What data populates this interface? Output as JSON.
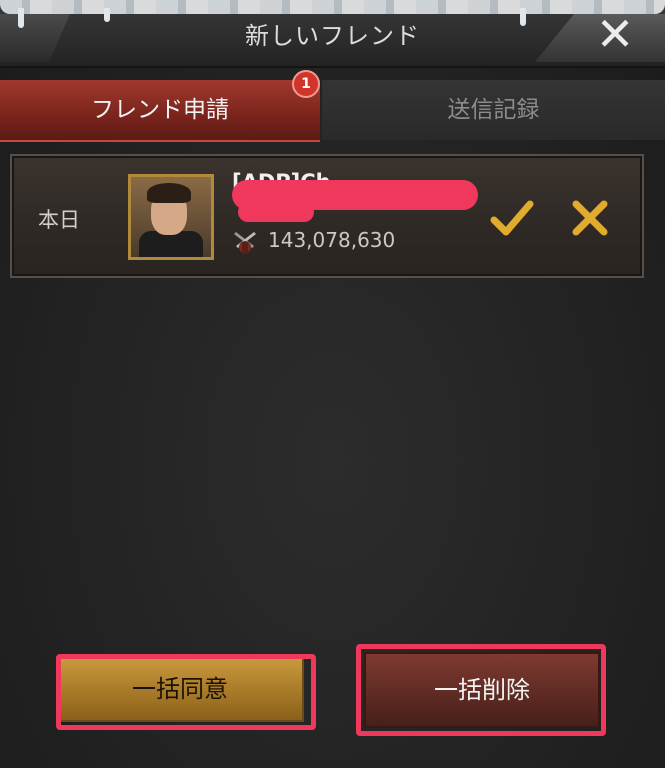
{
  "header": {
    "title": "新しいフレンド"
  },
  "tabs": [
    {
      "label": "フレンド申請",
      "active": true,
      "badge": "1"
    },
    {
      "label": "送信記録",
      "active": false
    }
  ],
  "request": {
    "date_label": "本日",
    "player_name": "[ADP]Ch..",
    "power": "143,078,630"
  },
  "actions": {
    "bulk_accept": "一括同意",
    "bulk_delete": "一括削除"
  },
  "colors": {
    "accent_red": "#a0392e",
    "accept_gold": "#d4a12b",
    "highlight": "#f0385c"
  }
}
